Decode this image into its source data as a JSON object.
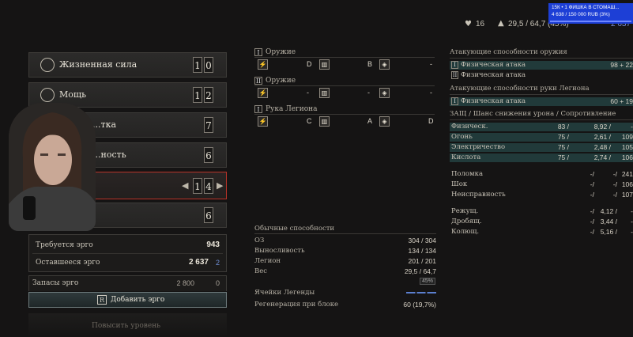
{
  "topbar": {
    "legion_count": "16",
    "weight": "29,5 / 64,7 (45%)",
    "ergo_small": "2 637",
    "donation_line1": "15К • 1 ФИШКА В СТОМАШ...",
    "donation_line2": "4 638 / 150 000 RUB (3%)"
  },
  "stats": [
    {
      "name": "Жизненная сила",
      "value": [
        "1",
        "0"
      ],
      "icon": "vitality-icon"
    },
    {
      "name": "Мощь",
      "value": [
        "1",
        "2"
      ],
      "icon": "capacity-icon"
    },
    {
      "name": "...тка",
      "value": [
        "7"
      ],
      "icon": "motivity-icon"
    },
    {
      "name": "...ность",
      "value": [
        "6"
      ],
      "icon": "technique-icon"
    },
    {
      "name": "",
      "value": [
        "1",
        "4"
      ],
      "icon": "advance-icon"
    },
    {
      "name": "",
      "value": [
        "6"
      ],
      "icon": "instinct-icon"
    }
  ],
  "ergo": {
    "required_label": "Требуется эрго",
    "required_value": "943",
    "remaining_label": "Оставшееся эрго",
    "remaining_value": "2 637",
    "remaining_extra": "2",
    "reserves_label": "Запасы эрго",
    "reserves_value": "2 800",
    "reserves_value2": "0",
    "add_button": "Добавить эрго",
    "add_key": "R",
    "level_up": "Повысить уровень"
  },
  "weapons": [
    {
      "roman": "I",
      "title": "Оружие",
      "grades": [
        "D",
        "B",
        "-"
      ]
    },
    {
      "roman": "II",
      "title": "Оружие",
      "grades": [
        "-",
        "-",
        "-"
      ]
    },
    {
      "roman": "I",
      "title": "Рука Легиона",
      "grades": [
        "C",
        "A",
        "D"
      ]
    }
  ],
  "common": {
    "title": "Обычные способности",
    "rows": [
      {
        "label": "ОЗ",
        "value": "304 /   304"
      },
      {
        "label": "Выносливость",
        "value": "134 /   134"
      },
      {
        "label": "Легион",
        "value": "201 /   201"
      },
      {
        "label": "Вес",
        "value": "29,5 /   64,7"
      }
    ],
    "weight_pct": "45%",
    "legend_cells_label": "Ячейки Легенды",
    "regen_label": "Регенерация при блоке",
    "regen_value": "60 (19,7%)"
  },
  "attack_weapon": {
    "title": "Атакующие способности оружия",
    "rows": [
      {
        "roman": "I",
        "label": "Физическая атака",
        "value": "98 + 22",
        "teal": true
      },
      {
        "roman": "II",
        "label": "Физическая атака",
        "value": "",
        "teal": false
      }
    ]
  },
  "attack_legion": {
    "title": "Атакующие способности руки Легиона",
    "rows": [
      {
        "roman": "I",
        "label": "Физическая атака",
        "value": "60 + 19",
        "teal": true
      }
    ]
  },
  "defense": {
    "title": "ЗАЩ / Шанс снижения урона / Сопротивление",
    "rows": [
      {
        "label": "Физическ.",
        "v1": "83 /",
        "v2": "8,92 /",
        "v3": "-",
        "teal": true
      },
      {
        "label": "Огонь",
        "v1": "75 /",
        "v2": "2,61 /",
        "v3": "109",
        "teal": true
      },
      {
        "label": "Электричество",
        "v1": "75 /",
        "v2": "2,48 /",
        "v3": "105",
        "teal": true
      },
      {
        "label": "Кислота",
        "v1": "75 /",
        "v2": "2,74 /",
        "v3": "106",
        "teal": true
      }
    ],
    "rows2": [
      {
        "label": "Поломка",
        "v1": "-/",
        "v2": "-/",
        "v3": "241"
      },
      {
        "label": "Шок",
        "v1": "-/",
        "v2": "-/",
        "v3": "106"
      },
      {
        "label": "Неисправность",
        "v1": "-/",
        "v2": "-/",
        "v3": "107"
      }
    ],
    "rows3": [
      {
        "label": "Режущ.",
        "v1": "-/",
        "v2": "4,12 /",
        "v3": "-"
      },
      {
        "label": "Дробящ.",
        "v1": "-/",
        "v2": "3,44 /",
        "v3": "-"
      },
      {
        "label": "Колющ.",
        "v1": "-/",
        "v2": "5,16 /",
        "v3": "-"
      }
    ]
  }
}
